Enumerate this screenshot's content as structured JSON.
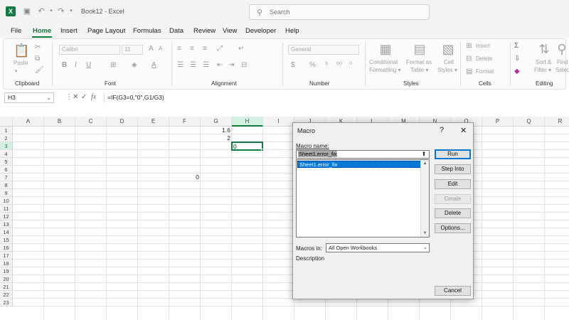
{
  "window": {
    "title": "Book12 - Excel"
  },
  "search": {
    "placeholder": "Search"
  },
  "menu": [
    "File",
    "Home",
    "Insert",
    "Page Layout",
    "Formulas",
    "Data",
    "Review",
    "View",
    "Developer",
    "Help"
  ],
  "ribbon": {
    "clipboard": {
      "paste_label": "Paste",
      "group_label": "Clipboard"
    },
    "font": {
      "font_name": "Calibri",
      "font_size": "11",
      "group_label": "Font"
    },
    "alignment": {
      "group_label": "Alignment"
    },
    "number": {
      "format": "General",
      "currency_symbol": "$",
      "percent_symbol": "%",
      "group_label": "Number"
    },
    "styles": {
      "conditional_line1": "Conditional",
      "conditional_line2": "Formatting ▾",
      "format_as_line1": "Format as",
      "format_as_line2": "Table ▾",
      "cell_styles_line1": "Cell",
      "cell_styles_line2": "Styles ▾",
      "group_label": "Styles"
    },
    "cells": {
      "insert_label": "Insert",
      "delete_label": "Delete",
      "format_label": "Format",
      "group_label": "Cells"
    },
    "editing": {
      "sort_line1": "Sort &",
      "sort_line2": "Filter ▾",
      "find_line1": "Find",
      "find_line2": "Selec",
      "group_label": "Editing"
    }
  },
  "formula_bar": {
    "name_box": "H3",
    "fx": "fx",
    "formula": "=IF(G3=0,\"0\",G1/G3)"
  },
  "grid": {
    "columns": [
      "A",
      "B",
      "C",
      "D",
      "E",
      "F",
      "G",
      "H",
      "I",
      "J",
      "K",
      "L",
      "M",
      "N",
      "O",
      "P",
      "Q",
      "R"
    ],
    "rows": [
      "1",
      "2",
      "3",
      "4",
      "5",
      "6",
      "7",
      "8",
      "9",
      "10",
      "11",
      "12",
      "13",
      "14",
      "15",
      "16",
      "17",
      "18",
      "19",
      "20",
      "21",
      "22",
      "23"
    ],
    "selected_column": "H",
    "selected_row": "3",
    "cells": {
      "G1": "1.6",
      "G2": "2",
      "H3": "0",
      "F7": "0"
    }
  },
  "dialog": {
    "title": "Macro",
    "help_symbol": "?",
    "close_symbol": "✕",
    "macro_name_label": "Macro name:",
    "macro_name_value": "Sheet1.error_fix",
    "list_items": [
      "Sheet1.error_fix"
    ],
    "macros_in_label": "Macros in:",
    "macros_in_value": "All Open Workbooks",
    "description_label": "Description",
    "buttons": {
      "run": "Run",
      "step_into": "Step Into",
      "edit": "Edit",
      "create": "Create",
      "delete": "Delete",
      "options": "Options...",
      "cancel": "Cancel"
    }
  },
  "colors": {
    "accent": "#107c41",
    "selection_blue": "#0078d7"
  }
}
